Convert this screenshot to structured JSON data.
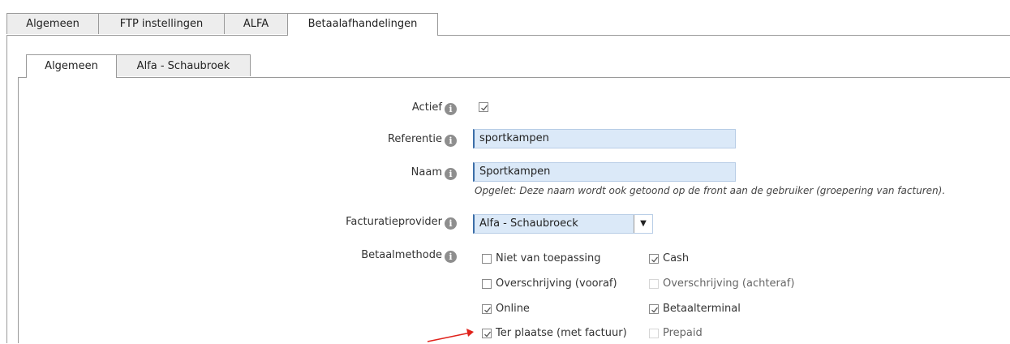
{
  "top_tabs": [
    {
      "label": "Algemeen",
      "active": false
    },
    {
      "label": "FTP instellingen",
      "active": false
    },
    {
      "label": "ALFA",
      "active": false
    },
    {
      "label": "Betaalafhandelingen",
      "active": true
    }
  ],
  "inner_tabs": [
    {
      "label": "Algemeen",
      "active": true
    },
    {
      "label": "Alfa - Schaubroek",
      "active": false
    }
  ],
  "form": {
    "actief": {
      "label": "Actief",
      "checked": true
    },
    "referentie": {
      "label": "Referentie",
      "value": "sportkampen"
    },
    "naam": {
      "label": "Naam",
      "value": "Sportkampen",
      "note": "Opgelet: Deze naam wordt ook getoond op de front aan de gebruiker (groepering van facturen)."
    },
    "facturatieprovider": {
      "label": "Facturatieprovider",
      "selected": "Alfa - Schaubroeck"
    },
    "betaalmethode": {
      "label": "Betaalmethode",
      "options": [
        {
          "label": "Niet van toepassing",
          "checked": false,
          "disabled": false
        },
        {
          "label": "Cash",
          "checked": true,
          "disabled": false
        },
        {
          "label": "Overschrijving (vooraf)",
          "checked": false,
          "disabled": false
        },
        {
          "label": "Overschrijving (achteraf)",
          "checked": false,
          "disabled": true
        },
        {
          "label": "Online",
          "checked": true,
          "disabled": false
        },
        {
          "label": "Betaalterminal",
          "checked": true,
          "disabled": false
        },
        {
          "label": "Ter plaatse (met factuur)",
          "checked": true,
          "disabled": false
        },
        {
          "label": "Prepaid",
          "checked": false,
          "disabled": true
        }
      ]
    }
  },
  "info_icon_glyph": "i",
  "colors": {
    "input_bg": "#dbe9f8",
    "arrow": "#e0231c",
    "tab_bg": "#ededed"
  }
}
